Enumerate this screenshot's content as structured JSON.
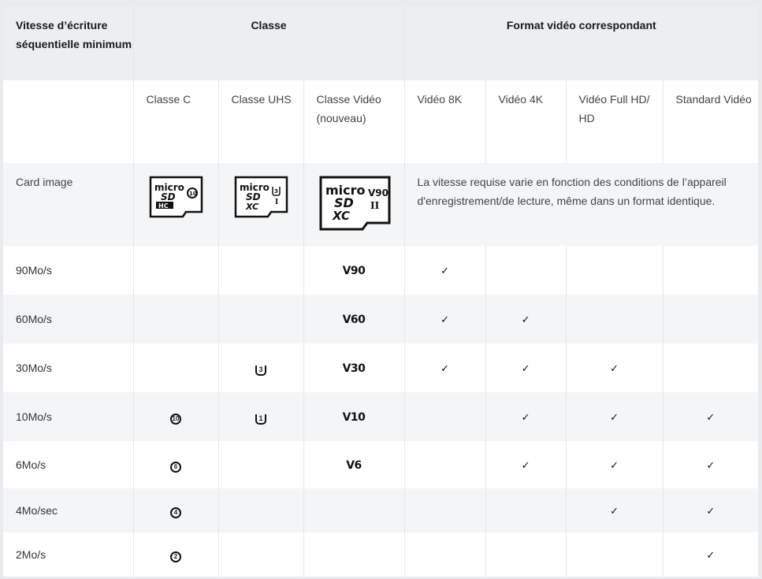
{
  "header": {
    "col1": "Vitesse d’écriture séquentielle minimum",
    "classe": "Classe",
    "format": "Format vidéo correspondant"
  },
  "subheader": {
    "classe_c": "Classe C",
    "classe_uhs": "Classe UHS",
    "classe_video": "Classe Vidéo (nouveau)",
    "video_8k": "Vidéo 8K",
    "video_4k": "Vidéo 4K",
    "video_fullhd": "Vidéo Full HD/ HD",
    "standard": "Standard Vidéo"
  },
  "card_row": {
    "label": "Card image",
    "card_c_logo": "micro SD HC 10",
    "card_uhs_logo": "micro SD XC U3 I",
    "card_video_logo": "micro SD XC V90 II",
    "note": "La vitesse requise varie en fonction des conditions de l’appareil d'enregistrement/de lecture, même dans un format identique."
  },
  "check": "✓",
  "rows": [
    {
      "speed": "90Mo/s",
      "c": "",
      "uhs": "",
      "video": "V90",
      "k8": true,
      "k4": false,
      "hd": false,
      "sd": false
    },
    {
      "speed": "60Mo/s",
      "c": "",
      "uhs": "",
      "video": "V60",
      "k8": true,
      "k4": true,
      "hd": false,
      "sd": false
    },
    {
      "speed": "30Mo/s",
      "c": "",
      "uhs": "3",
      "video": "V30",
      "k8": true,
      "k4": true,
      "hd": true,
      "sd": false
    },
    {
      "speed": "10Mo/s",
      "c": "10",
      "uhs": "1",
      "video": "V10",
      "k8": false,
      "k4": true,
      "hd": true,
      "sd": true
    },
    {
      "speed": "6Mo/s",
      "c": "6",
      "uhs": "",
      "video": "V6",
      "k8": false,
      "k4": true,
      "hd": true,
      "sd": true
    },
    {
      "speed": "4Mo/sec",
      "c": "4",
      "uhs": "",
      "video": "",
      "k8": false,
      "k4": false,
      "hd": true,
      "sd": true
    },
    {
      "speed": "2Mo/s",
      "c": "2",
      "uhs": "",
      "video": "",
      "k8": false,
      "k4": false,
      "hd": false,
      "sd": true
    }
  ]
}
